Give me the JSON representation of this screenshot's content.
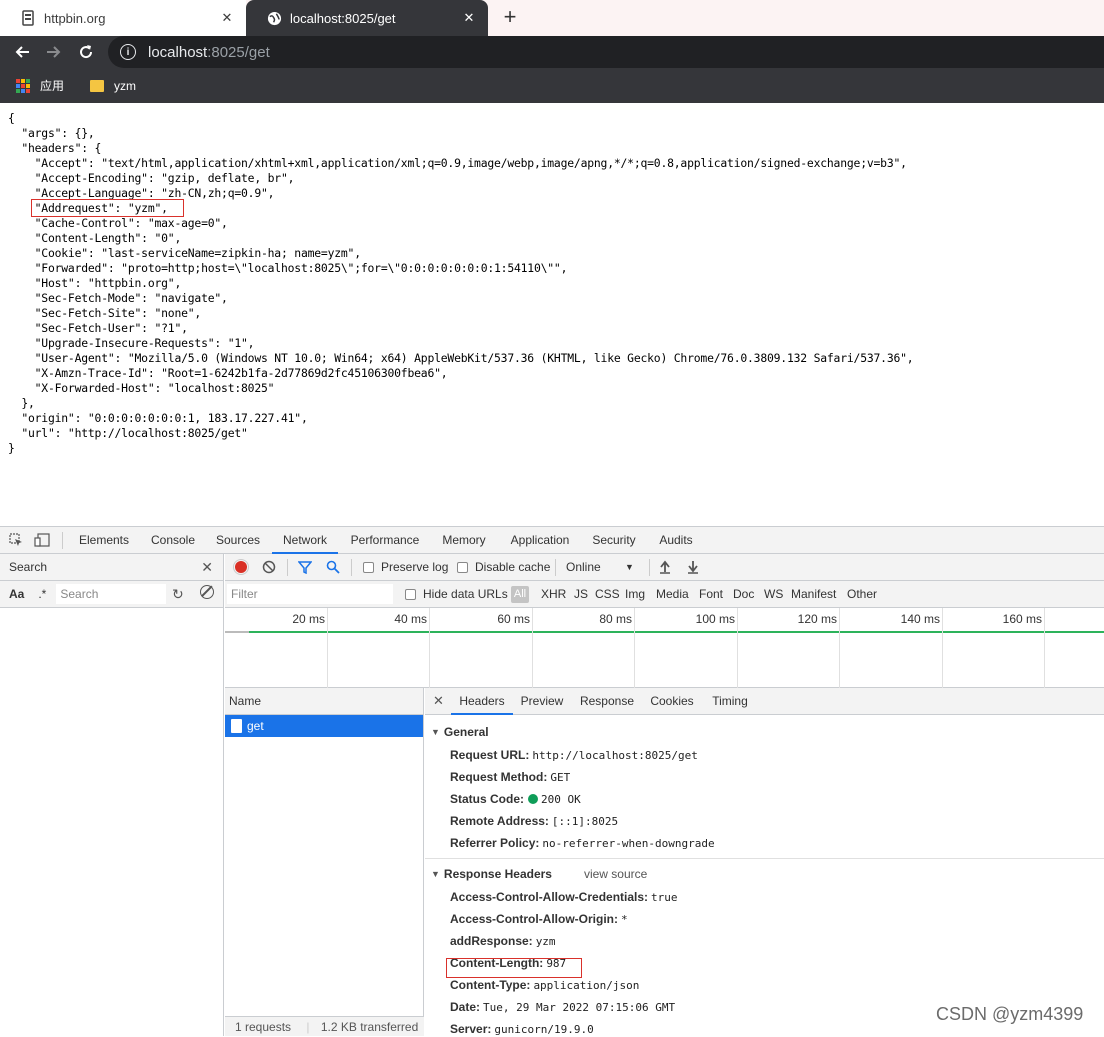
{
  "browser": {
    "tabs": [
      {
        "title": "httpbin.org",
        "active": false
      },
      {
        "title": "localhost:8025/get",
        "active": true
      }
    ],
    "new_tab_symbol": "+",
    "close_symbol": "✕",
    "url_host": "localhost",
    "url_rest": ":8025/get",
    "bookmarks": [
      {
        "label": "应用",
        "icon": "apps-grid-icon"
      },
      {
        "label": "yzm",
        "icon": "folder-icon"
      }
    ]
  },
  "page": {
    "json_lines": [
      "{",
      "  \"args\": {},",
      "  \"headers\": {",
      "    \"Accept\": \"text/html,application/xhtml+xml,application/xml;q=0.9,image/webp,image/apng,*/*;q=0.8,application/signed-exchange;v=b3\",",
      "    \"Accept-Encoding\": \"gzip, deflate, br\",",
      "    \"Accept-Language\": \"zh-CN,zh;q=0.9\",",
      "    \"Addrequest\": \"yzm\",",
      "    \"Cache-Control\": \"max-age=0\",",
      "    \"Content-Length\": \"0\",",
      "    \"Cookie\": \"last-serviceName=zipkin-ha; name=yzm\",",
      "    \"Forwarded\": \"proto=http;host=\\\"localhost:8025\\\";for=\\\"0:0:0:0:0:0:0:1:54110\\\"\",",
      "    \"Host\": \"httpbin.org\",",
      "    \"Sec-Fetch-Mode\": \"navigate\",",
      "    \"Sec-Fetch-Site\": \"none\",",
      "    \"Sec-Fetch-User\": \"?1\",",
      "    \"Upgrade-Insecure-Requests\": \"1\",",
      "    \"User-Agent\": \"Mozilla/5.0 (Windows NT 10.0; Win64; x64) AppleWebKit/537.36 (KHTML, like Gecko) Chrome/76.0.3809.132 Safari/537.36\",",
      "    \"X-Amzn-Trace-Id\": \"Root=1-6242b1fa-2d77869d2fc45106300fbea6\",",
      "    \"X-Forwarded-Host\": \"localhost:8025\"",
      "  },",
      "  \"origin\": \"0:0:0:0:0:0:0:1, 183.17.227.41\",",
      "  \"url\": \"http://localhost:8025/get\"",
      "}"
    ]
  },
  "devtools": {
    "tabs": [
      "Elements",
      "Console",
      "Sources",
      "Network",
      "Performance",
      "Memory",
      "Application",
      "Security",
      "Audits"
    ],
    "active_tab": "Network",
    "search": {
      "title": "Search",
      "aa": "Aa",
      "regex": ".*",
      "placeholder": "Search"
    },
    "network": {
      "preserve_log": "Preserve log",
      "disable_cache": "Disable cache",
      "throttle": "Online",
      "filter_placeholder": "Filter",
      "hide_data_urls": "Hide data URLs",
      "types": [
        "All",
        "XHR",
        "JS",
        "CSS",
        "Img",
        "Media",
        "Font",
        "Doc",
        "WS",
        "Manifest",
        "Other"
      ],
      "timeline_ticks": [
        "20 ms",
        "40 ms",
        "60 ms",
        "80 ms",
        "100 ms",
        "120 ms",
        "140 ms",
        "160 ms"
      ],
      "name_header": "Name",
      "requests": [
        "get"
      ],
      "footer_requests": "1 requests",
      "footer_transferred": "1.2 KB transferred"
    },
    "detail": {
      "tabs": [
        "Headers",
        "Preview",
        "Response",
        "Cookies",
        "Timing"
      ],
      "active_tab": "Headers",
      "general_title": "General",
      "general": [
        {
          "k": "Request URL:",
          "v": "http://localhost:8025/get"
        },
        {
          "k": "Request Method:",
          "v": "GET"
        },
        {
          "k": "Status Code:",
          "v": "200 OK"
        },
        {
          "k": "Remote Address:",
          "v": "[::1]:8025"
        },
        {
          "k": "Referrer Policy:",
          "v": "no-referrer-when-downgrade"
        }
      ],
      "response_title": "Response Headers",
      "view_source": "view source",
      "response": [
        {
          "k": "Access-Control-Allow-Credentials:",
          "v": "true"
        },
        {
          "k": "Access-Control-Allow-Origin:",
          "v": "*"
        },
        {
          "k": "addResponse:",
          "v": "yzm"
        },
        {
          "k": "Content-Length:",
          "v": "987"
        },
        {
          "k": "Content-Type:",
          "v": "application/json"
        },
        {
          "k": "Date:",
          "v": "Tue, 29 Mar 2022 07:15:06 GMT"
        },
        {
          "k": "Server:",
          "v": "gunicorn/19.9.0"
        }
      ]
    }
  },
  "watermark": "CSDN @yzm4399",
  "colors": {
    "accent": "#1a73e8",
    "highlight_box": "#d9312b",
    "status_ok": "#0f9d58",
    "record": "#d93025"
  }
}
